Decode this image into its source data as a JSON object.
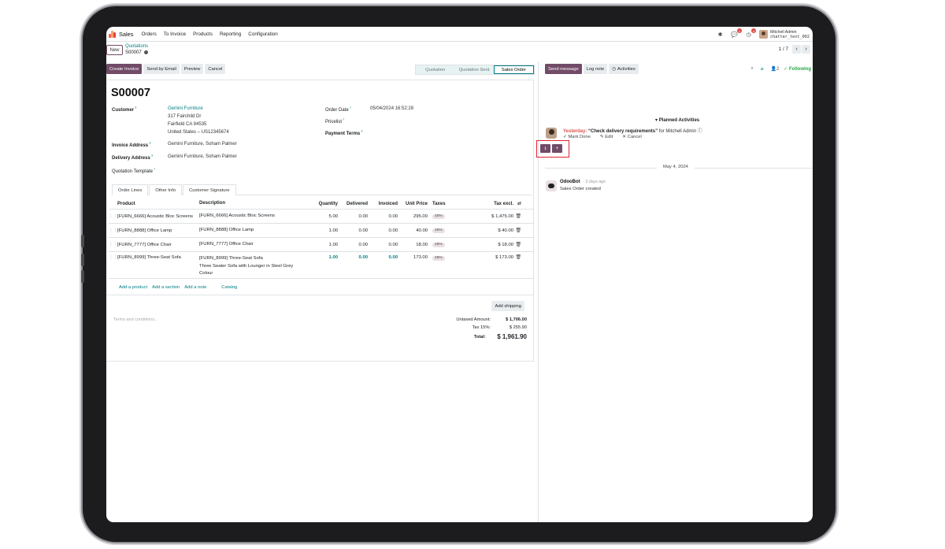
{
  "navbar": {
    "app_name": "Sales",
    "menu": [
      "Orders",
      "To Invoice",
      "Products",
      "Reporting",
      "Configuration"
    ],
    "chat_badge": "1",
    "activity_badge": "4",
    "user_name": "Mitchell Admin",
    "db_name": "chatter_test_002"
  },
  "control": {
    "new_label": "New",
    "breadcrumb_parent": "Quotations",
    "breadcrumb_current": "S00007",
    "pager": "1 / 7"
  },
  "buttons": {
    "create_invoice": "Create Invoice",
    "send_email": "Send by Email",
    "preview": "Preview",
    "cancel": "Cancel"
  },
  "status": [
    "Quotation",
    "Quotation Sent",
    "Sales Order"
  ],
  "form": {
    "title": "S00007",
    "customer_label": "Customer",
    "customer_name": "Gemini Furniture",
    "customer_addr1": "317 Fairchild Dr",
    "customer_addr2": "Fairfield CA 94535",
    "customer_addr3": "United States – US12345674",
    "invoice_label": "Invoice Address",
    "invoice_value": "Gemini Furniture, Soham Palmer",
    "delivery_label": "Delivery Address",
    "delivery_value": "Gemini Furniture, Soham Palmer",
    "template_label": "Quotation Template",
    "order_date_label": "Order Date",
    "order_date_value": "05/04/2024 16:52:28",
    "pricelist_label": "Pricelist",
    "payment_label": "Payment Terms"
  },
  "tabs": [
    "Order Lines",
    "Other Info",
    "Customer Signature"
  ],
  "lines_header": {
    "product": "Product",
    "description": "Description",
    "quantity": "Quantity",
    "delivered": "Delivered",
    "invoiced": "Invoiced",
    "unit_price": "Unit Price",
    "taxes": "Taxes",
    "tax_excl": "Tax excl."
  },
  "lines": [
    {
      "product": "[FURN_6666] Acoustic Bloc Screens",
      "desc1": "[FURN_6666] Acoustic Bloc Screens",
      "desc2": "",
      "desc3": "",
      "qty": "5.00",
      "delivered": "0.00",
      "invoiced": "0.00",
      "price": "295.00",
      "tax": "15%",
      "subtotal": "$ 1,475.00"
    },
    {
      "product": "[FURN_8888] Office Lamp",
      "desc1": "[FURN_8888] Office Lamp",
      "desc2": "",
      "desc3": "",
      "qty": "1.00",
      "delivered": "0.00",
      "invoiced": "0.00",
      "price": "40.00",
      "tax": "15%",
      "subtotal": "$ 40.00"
    },
    {
      "product": "[FURN_7777] Office Chair",
      "desc1": "[FURN_7777] Office Chair",
      "desc2": "",
      "desc3": "",
      "qty": "1.00",
      "delivered": "0.00",
      "invoiced": "0.00",
      "price": "18.00",
      "tax": "15%",
      "subtotal": "$ 18.00"
    },
    {
      "product": "[FURN_8999] Three-Seat Sofa",
      "desc1": "[FURN_8999] Three-Seat Sofa",
      "desc2": "Three Seater Sofa with Lounger in Steel Grey",
      "desc3": "Colour",
      "qty": "1.00",
      "delivered": "0.00",
      "invoiced": "0.00",
      "price": "173.00",
      "tax": "15%",
      "subtotal": "$ 173.00"
    }
  ],
  "add_links": {
    "product": "Add a product",
    "section": "Add a section",
    "note": "Add a note",
    "catalog": "Catalog"
  },
  "footer": {
    "add_shipping": "Add shipping",
    "terms_placeholder": "Terms and conditions...",
    "untaxed_label": "Untaxed Amount:",
    "untaxed_value": "$ 1,706.00",
    "tax_label": "Tax 15%:",
    "tax_value": "$ 255.90",
    "total_label": "Total:",
    "total_value": "$ 1,961.90"
  },
  "chatter": {
    "send_message": "Send message",
    "log_note": "Log note",
    "activities": "Activities",
    "followers_count": "2",
    "following": "Following",
    "planned_title": "Planned Activities",
    "activity_when": "Yesterday:",
    "activity_summary": "“Check delivery requirements”",
    "activity_for": "for Mitchell Admin",
    "mark_done": "Mark Done",
    "edit": "Edit",
    "cancel": "Cancel",
    "date_separator": "May 4, 2024",
    "bot_name": "OdooBot",
    "bot_time": "- 3 days ago",
    "bot_message": "Sales Order created"
  }
}
